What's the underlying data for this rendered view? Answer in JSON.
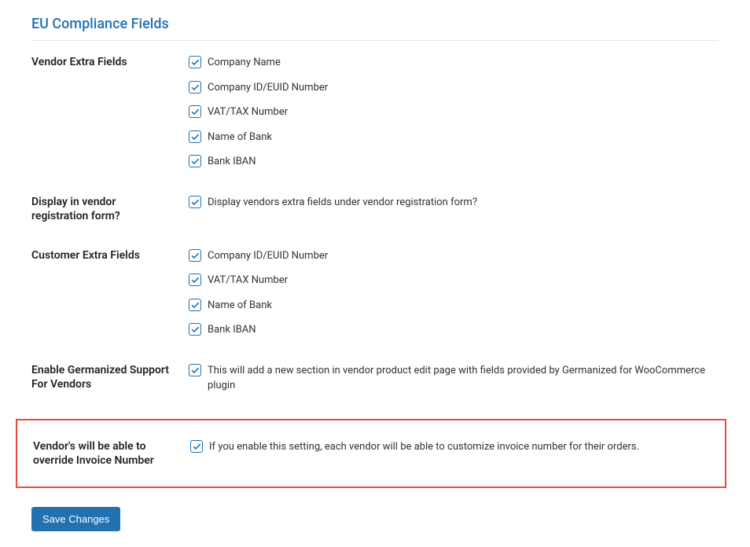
{
  "section_title": "EU Compliance Fields",
  "vendor_extra_fields": {
    "label": "Vendor Extra Fields",
    "items": [
      {
        "label": "Company Name",
        "checked": true
      },
      {
        "label": "Company ID/EUID Number",
        "checked": true
      },
      {
        "label": "VAT/TAX Number",
        "checked": true
      },
      {
        "label": "Name of Bank",
        "checked": true
      },
      {
        "label": "Bank IBAN",
        "checked": true
      }
    ]
  },
  "display_in_registration": {
    "label": "Display in vendor registration form?",
    "item": {
      "label": "Display vendors extra fields under vendor registration form?",
      "checked": true
    }
  },
  "customer_extra_fields": {
    "label": "Customer Extra Fields",
    "items": [
      {
        "label": "Company ID/EUID Number",
        "checked": true
      },
      {
        "label": "VAT/TAX Number",
        "checked": true
      },
      {
        "label": "Name of Bank",
        "checked": true
      },
      {
        "label": "Bank IBAN",
        "checked": true
      }
    ]
  },
  "germanized_support": {
    "label": "Enable Germanized Support For Vendors",
    "item": {
      "label": "This will add a new section in vendor product edit page with fields provided by Germanized for WooCommerce plugin",
      "checked": true
    }
  },
  "invoice_override": {
    "label": "Vendor's will be able to override Invoice Number",
    "item": {
      "label": "If you enable this setting, each vendor will be able to customize invoice number for their orders.",
      "checked": true
    }
  },
  "save_button": "Save Changes"
}
